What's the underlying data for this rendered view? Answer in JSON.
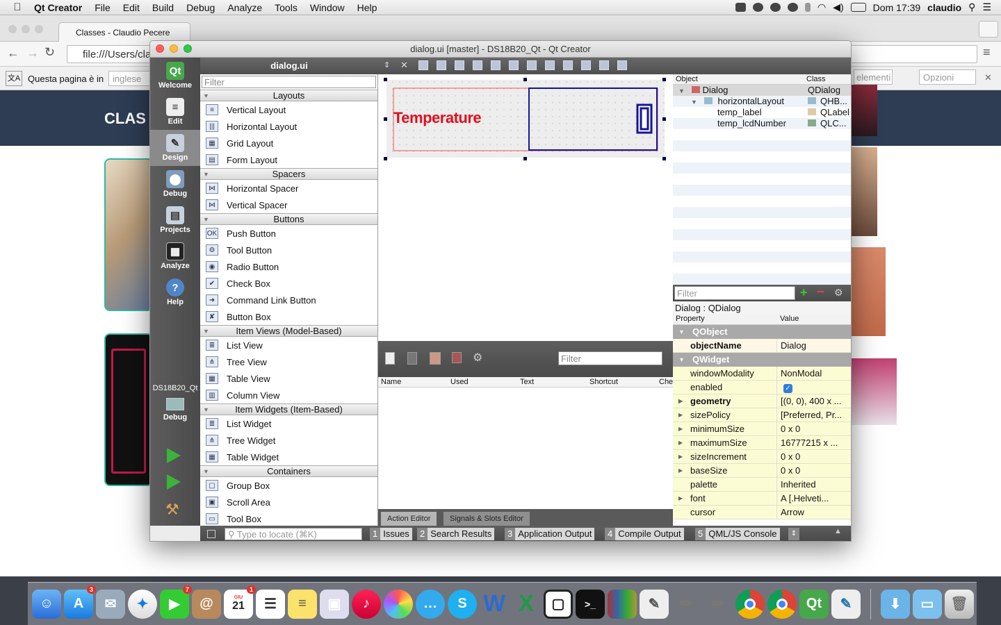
{
  "menubar": {
    "app": "Qt Creator",
    "items": [
      "File",
      "Edit",
      "Build",
      "Debug",
      "Analyze",
      "Tools",
      "Window",
      "Help"
    ],
    "clock": "Dom 17:39",
    "user": "claudio"
  },
  "browser": {
    "tab_title": "Classes - Claudio Pecere",
    "url": "file:///Users/cla",
    "translate_text": "Questa pagina è in",
    "translate_lang": "inglese",
    "find_placeholder": "elementi",
    "options_label": "Opzioni",
    "hero_text": "CLAS"
  },
  "window": {
    "title": "dialog.ui [master] - DS18B20_Qt - Qt Creator"
  },
  "modes": [
    {
      "label": "Welcome",
      "icon": "qt-logo-icon"
    },
    {
      "label": "Edit",
      "icon": "edit-icon"
    },
    {
      "label": "Design",
      "icon": "design-icon"
    },
    {
      "label": "Debug",
      "icon": "debug-icon"
    },
    {
      "label": "Projects",
      "icon": "projects-icon"
    },
    {
      "label": "Analyze",
      "icon": "analyze-icon"
    },
    {
      "label": "Help",
      "icon": "help-icon"
    }
  ],
  "kit": {
    "project": "DS18B20_Qt",
    "config": "Debug"
  },
  "widgetbox": {
    "file": "dialog.ui",
    "filter_placeholder": "Filter",
    "categories": [
      {
        "name": "Layouts",
        "items": [
          "Vertical Layout",
          "Horizontal Layout",
          "Grid Layout",
          "Form Layout"
        ]
      },
      {
        "name": "Spacers",
        "items": [
          "Horizontal Spacer",
          "Vertical Spacer"
        ]
      },
      {
        "name": "Buttons",
        "items": [
          "Push Button",
          "Tool Button",
          "Radio Button",
          "Check Box",
          "Command Link Button",
          "Button Box"
        ]
      },
      {
        "name": "Item Views (Model-Based)",
        "items": [
          "List View",
          "Tree View",
          "Table View",
          "Column View"
        ]
      },
      {
        "name": "Item Widgets (Item-Based)",
        "items": [
          "List Widget",
          "Tree Widget",
          "Table Widget"
        ]
      },
      {
        "name": "Containers",
        "items": [
          "Group Box",
          "Scroll Area",
          "Tool Box"
        ]
      }
    ]
  },
  "form": {
    "label_text": "Temperature",
    "lcd_value": "0",
    "label_color": "#e0101e"
  },
  "action_editor": {
    "filter_placeholder": "Filter",
    "columns": [
      "Name",
      "Used",
      "Text",
      "Shortcut",
      "Che"
    ],
    "tabs": [
      "Action Editor",
      "Signals & Slots Editor"
    ]
  },
  "object_inspector": {
    "columns": [
      "Object",
      "Class"
    ],
    "rows": [
      {
        "name": "Dialog",
        "class": "QDialog"
      },
      {
        "name": "horizontalLayout",
        "class": "QHB..."
      },
      {
        "name": "temp_label",
        "class": "QLabel"
      },
      {
        "name": "temp_lcdNumber",
        "class": "QLC..."
      }
    ]
  },
  "property_editor": {
    "filter_placeholder": "Filter",
    "info": "Dialog : QDialog",
    "columns": [
      "Property",
      "Value"
    ],
    "groups": [
      {
        "name": "QObject",
        "props": [
          {
            "name": "objectName",
            "value": "Dialog"
          }
        ]
      },
      {
        "name": "QWidget",
        "props": [
          {
            "name": "windowModality",
            "value": "NonModal"
          },
          {
            "name": "enabled",
            "value": "✓"
          },
          {
            "name": "geometry",
            "value": "[(0, 0), 400 x ..."
          },
          {
            "name": "sizePolicy",
            "value": "[Preferred, Pr..."
          },
          {
            "name": "minimumSize",
            "value": "0 x 0"
          },
          {
            "name": "maximumSize",
            "value": "16777215 x ..."
          },
          {
            "name": "sizeIncrement",
            "value": "0 x 0"
          },
          {
            "name": "baseSize",
            "value": "0 x 0"
          },
          {
            "name": "palette",
            "value": "Inherited"
          },
          {
            "name": "font",
            "value": "A  [.Helveti..."
          },
          {
            "name": "cursor",
            "value": "Arrow"
          }
        ]
      }
    ]
  },
  "bottom": {
    "locate_placeholder": "Type to locate (⌘K)",
    "panes": [
      {
        "num": "1",
        "label": "Issues"
      },
      {
        "num": "2",
        "label": "Search Results"
      },
      {
        "num": "3",
        "label": "Application Output"
      },
      {
        "num": "4",
        "label": "Compile Output"
      },
      {
        "num": "5",
        "label": "QML/JS Console"
      }
    ]
  },
  "dock": {
    "badges": {
      "appstore": "3",
      "facetime": "7",
      "calendar": "1"
    },
    "calendar_day": "21",
    "calendar_month": "GIU"
  }
}
